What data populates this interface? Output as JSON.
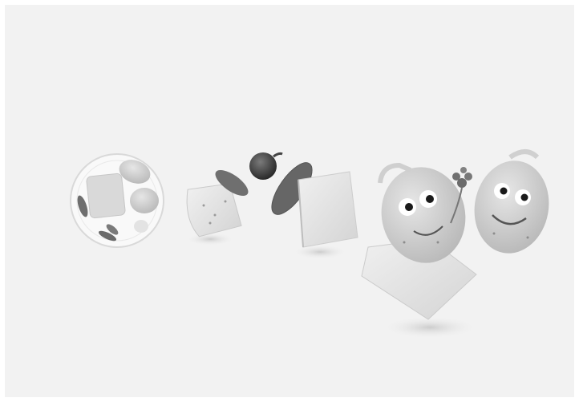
{
  "image": {
    "description_visible_text": "",
    "palette": {
      "background": "#f2f2f2",
      "frame_border": "#ffffff",
      "plate": "#f7f7f7",
      "cheese": "#dedede",
      "potato": "#d2d2d2",
      "pickle": "#6f6f6f",
      "onion": "#3a3a3a",
      "eye_white": "#ffffff",
      "pupil": "#1a1a1a"
    },
    "objects": [
      {
        "name": "raclette-plate"
      },
      {
        "name": "cheese-slice-left"
      },
      {
        "name": "pickle-slice"
      },
      {
        "name": "onion"
      },
      {
        "name": "pickle-large"
      },
      {
        "name": "cheese-block-center"
      },
      {
        "name": "potato-character-left"
      },
      {
        "name": "parsley-sprig"
      },
      {
        "name": "potato-character-right"
      },
      {
        "name": "cheese-slice-bottom"
      }
    ]
  }
}
